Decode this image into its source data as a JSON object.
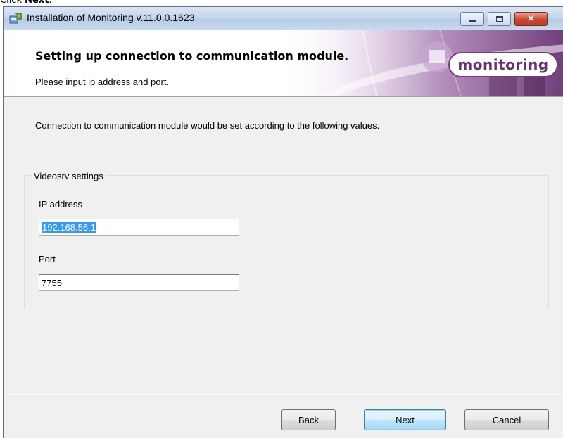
{
  "caption": {
    "prefix": "Click ",
    "bold": "Next",
    "suffix": "."
  },
  "window": {
    "title": "Installation of Monitoring v.11.0.0.1623",
    "icon": "installer-package-icon",
    "controls": {
      "minimize": "minimize-icon",
      "maximize": "maximize-icon",
      "close": "close-icon"
    }
  },
  "banner": {
    "title": "Setting up connection to communication module.",
    "subtitle": "Please input ip address and port.",
    "logo_text": "monitoring",
    "logo_color": "#6a2f6e"
  },
  "main": {
    "description": "Connection to communication module would be set according to the following values.",
    "group": {
      "legend": "Videosrv settings",
      "ip_label": "IP address",
      "ip_value": "192.168.56.1",
      "port_label": "Port",
      "port_value": "7755"
    }
  },
  "buttons": {
    "back": "Back",
    "next": "Next",
    "cancel": "Cancel"
  },
  "colors": {
    "selection": "#3399ff",
    "dialog_bg": "#f0f0f0",
    "default_button_border": "#3c7fb1"
  }
}
